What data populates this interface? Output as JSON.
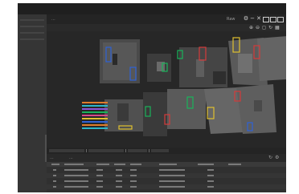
{
  "app": {
    "viewer_title": "...",
    "window_label": "Raw",
    "results_tabs": [
      "...",
      "..."
    ]
  },
  "icons": {
    "close": "close-icon",
    "restore": "restore-icon",
    "minimize": "minimize-icon",
    "settings": "gear-icon",
    "zoom_in": "zoom-in-icon",
    "zoom_out": "zoom-out-icon",
    "fit": "fit-icon",
    "grid": "grid-icon",
    "export": "export-icon",
    "refresh": "refresh-icon"
  },
  "colors": {
    "app_bg": "#2c2c2c",
    "panel": "#353535",
    "header": "#242424",
    "detection_blue": "#2e62d6",
    "detection_green": "#19b35a",
    "detection_red": "#d43a3a",
    "detection_yellow": "#e0c030",
    "label_orange": "#e07b2b",
    "label_cyan": "#2cb5c9",
    "label_purple": "#8a55d8",
    "label_pink": "#d64a8a"
  },
  "results": {
    "rows": [
      {
        "id": "..."
      },
      {
        "id": "..."
      },
      {
        "id": "..."
      },
      {
        "id": "..."
      }
    ]
  }
}
